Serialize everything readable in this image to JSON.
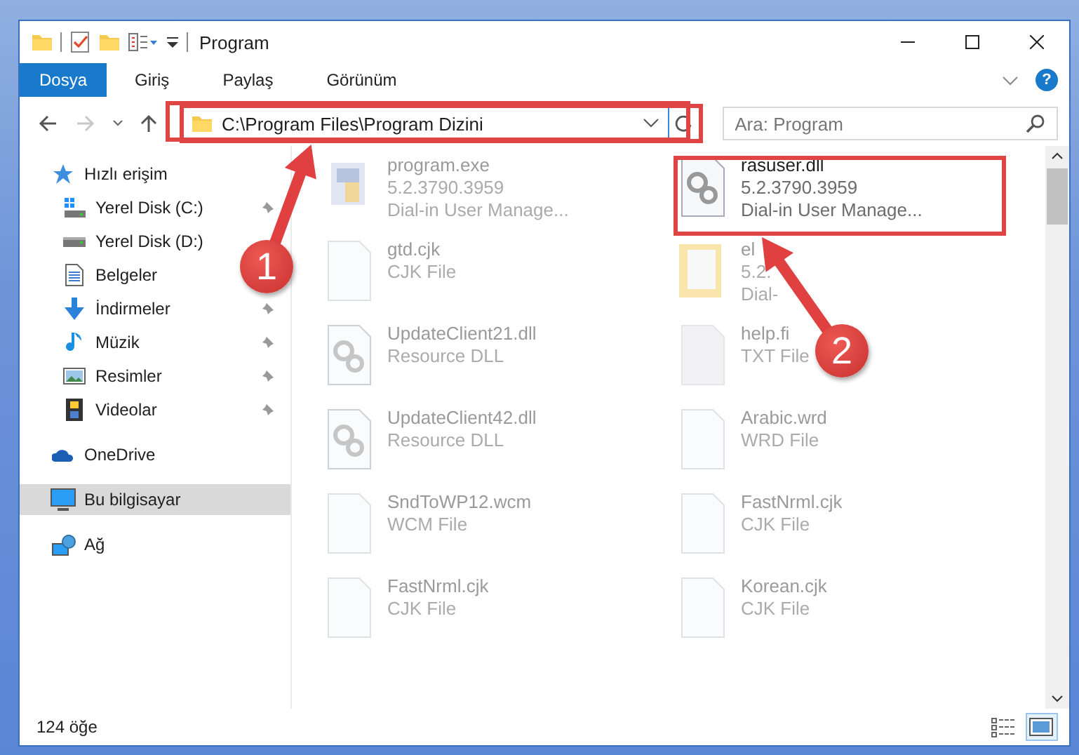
{
  "window": {
    "title": "Program"
  },
  "ribbon": {
    "tabs": [
      {
        "label": "Dosya",
        "kind": "file"
      },
      {
        "label": "Giriş",
        "kind": "tab"
      },
      {
        "label": "Paylaş",
        "kind": "tab"
      },
      {
        "label": "Görünüm",
        "kind": "tab"
      }
    ],
    "help": "?"
  },
  "navigation": {
    "back_disabled": false,
    "forward_disabled": true
  },
  "address_bar": {
    "path": "C:\\Program Files\\Program Dizini"
  },
  "search": {
    "placeholder": "Ara: Program"
  },
  "sidebar": {
    "items": [
      {
        "label": "Hızlı erişim",
        "kind": "star",
        "selected": false,
        "children": [
          {
            "label": "Yerel Disk (C:)",
            "kind": "windisk",
            "pinned": true,
            "selected": false
          },
          {
            "label": "Yerel Disk (D:)",
            "kind": "disk",
            "pinned": false,
            "selected": false
          },
          {
            "label": "Belgeler",
            "kind": "docs",
            "pinned": false,
            "selected": false
          },
          {
            "label": "İndirmeler",
            "kind": "download",
            "pinned": true,
            "selected": false
          },
          {
            "label": "Müzik",
            "kind": "music",
            "pinned": true,
            "selected": false
          },
          {
            "label": "Resimler",
            "kind": "pictures",
            "pinned": true,
            "selected": false
          },
          {
            "label": "Videolar",
            "kind": "videos",
            "pinned": true,
            "selected": false
          }
        ]
      },
      {
        "label": "OneDrive",
        "kind": "cloud",
        "selected": false
      },
      {
        "label": "Bu bilgisayar",
        "kind": "pc",
        "selected": true
      },
      {
        "label": "Ağ",
        "kind": "network",
        "selected": false
      }
    ]
  },
  "files": [
    {
      "name": "program.exe",
      "lines": [
        "5.2.3790.3959",
        "Dial-in User Manage..."
      ],
      "kind": "exe",
      "dimmed": true
    },
    {
      "name": "rasuser.dll",
      "lines": [
        "5.2.3790.3959",
        "Dial-in User Manage..."
      ],
      "kind": "dll",
      "dimmed": false
    },
    {
      "name": "gtd.cjk",
      "lines": [
        "CJK File"
      ],
      "kind": "file",
      "dimmed": true
    },
    {
      "name": "el",
      "lines": [
        "5.2.",
        "Dial-"
      ],
      "kind": "folderdoc",
      "dimmed": true
    },
    {
      "name": "UpdateClient21.dll",
      "lines": [
        "Resource DLL"
      ],
      "kind": "dll",
      "dimmed": true
    },
    {
      "name": "help.fi",
      "lines": [
        "TXT File"
      ],
      "kind": "txt",
      "dimmed": true
    },
    {
      "name": "UpdateClient42.dll",
      "lines": [
        "Resource DLL"
      ],
      "kind": "dll",
      "dimmed": true
    },
    {
      "name": "Arabic.wrd",
      "lines": [
        "WRD File"
      ],
      "kind": "file",
      "dimmed": true
    },
    {
      "name": "SndToWP12.wcm",
      "lines": [
        "WCM File"
      ],
      "kind": "file",
      "dimmed": true
    },
    {
      "name": "FastNrml.cjk",
      "lines": [
        "CJK File"
      ],
      "kind": "file",
      "dimmed": true
    },
    {
      "name": "FastNrml.cjk",
      "lines": [
        "CJK File"
      ],
      "kind": "file",
      "dimmed": true
    },
    {
      "name": "Korean.cjk",
      "lines": [
        "CJK File"
      ],
      "kind": "file",
      "dimmed": true
    }
  ],
  "status_bar": {
    "count": "124 öğe",
    "views": [
      {
        "kind": "details",
        "selected": false
      },
      {
        "kind": "large",
        "selected": true
      }
    ]
  },
  "annotations": [
    {
      "label": "1"
    },
    {
      "label": "2"
    }
  ]
}
